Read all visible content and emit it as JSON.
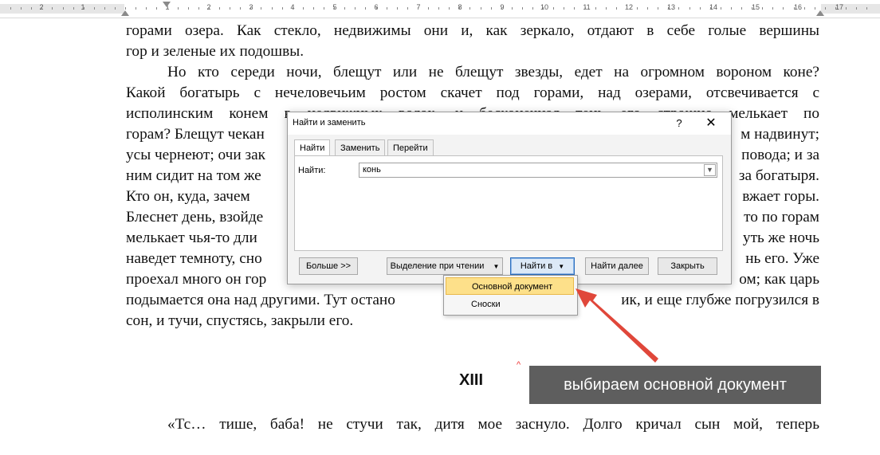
{
  "ruler": {
    "numbers": [
      "2",
      "1",
      "1",
      "2",
      "3",
      "4",
      "5",
      "6",
      "7",
      "8",
      "9",
      "10",
      "11",
      "12",
      "13",
      "14",
      "15",
      "16",
      "17"
    ]
  },
  "document": {
    "lines_top": [
      "горами озера. Как стекло, недвижимы они и, как зеркало, отдают в себе голые вершины",
      "гор и зеленые их подошвы.",
      "Но кто середи ночи, блещут или не блещут звезды, едет на огромном вороном коне?",
      "Какой богатырь с нечеловечьим ростом скачет под горами, над озерами, отсвечивается с",
      "исполинским конем в недвижных водах, и бесконечная тень его страшно мелькает по"
    ],
    "lines_left": [
      "горам? Блещут чекан",
      "усы чернеют; очи зак",
      "ним сидит на том же",
      "Кто он, куда, зачем",
      "Блеснет день, взойде",
      "мелькает чья-то дли",
      "наведет темноту, сно",
      "проехал много он гор",
      "подымается она над другими. Тут остано"
    ],
    "lines_right": [
      "м надвинут;",
      "повода; и за",
      "за богатыря.",
      "вжает горы.",
      "то по горам",
      "уть же ночь",
      "нь его. Уже",
      "ом; как царь",
      "ик, и еще глубже погрузился в"
    ],
    "line_last": "сон, и тучи, спустясь, закрыли его.",
    "heading": "XIII",
    "bottom_line": "«Тс… тише, баба! не стучи так, дитя мое заснуло. Долго кричал сын мой, теперь",
    "caret": "^"
  },
  "dialog": {
    "title": "Найти и заменить",
    "help": "?",
    "close": "✕",
    "tabs": [
      "Найти",
      "Заменить",
      "Перейти"
    ],
    "find_label": "Найти:",
    "find_value": "конь",
    "buttons": {
      "more": "Больше >>",
      "reading_highlight": "Выделение при чтении",
      "find_in": "Найти в",
      "find_next": "Найти далее",
      "close": "Закрыть"
    }
  },
  "dropdown": {
    "items": [
      "Основной документ",
      "Сноски"
    ],
    "highlighted": "Основной документ"
  },
  "annotation": {
    "text": "выбираем основной документ",
    "arrow_color": "#e0473a",
    "box_color": "#5e5e5e"
  }
}
